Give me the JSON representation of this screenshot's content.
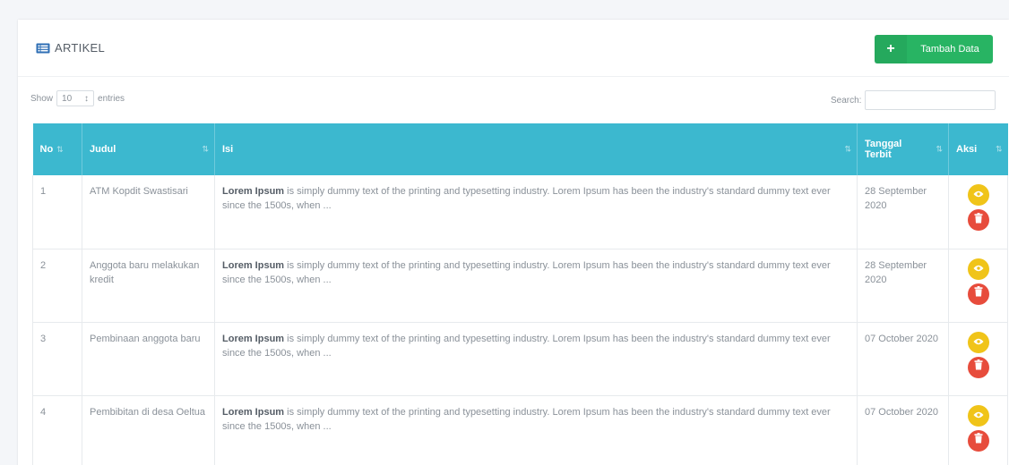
{
  "card": {
    "title": "ARTIKEL",
    "title_icon": "list-alt-icon",
    "add_button": {
      "icon": "plus-icon",
      "label": "Tambah Data"
    }
  },
  "length_menu": {
    "prefix": "Show",
    "value": "10",
    "suffix": "entries"
  },
  "search": {
    "label": "Search:",
    "value": "",
    "placeholder": ""
  },
  "table": {
    "headers": {
      "no": "No",
      "judul": "Judul",
      "isi": "Isi",
      "tanggal_line1": "Tanggal",
      "tanggal_line2": "Terbit",
      "aksi": "Aksi"
    },
    "rows": [
      {
        "no": "1",
        "judul": "ATM Kopdit Swastisari",
        "isi_bold": "Lorem Ipsum",
        "isi_rest": " is simply dummy text of the printing and typesetting industry. Lorem Ipsum has been the industry's standard dummy text ever since the 1500s, when ...",
        "tanggal": "28 September 2020"
      },
      {
        "no": "2",
        "judul": "Anggota baru melakukan kredit",
        "isi_bold": "Lorem Ipsum",
        "isi_rest": " is simply dummy text of the printing and typesetting industry. Lorem Ipsum has been the industry's standard dummy text ever since the 1500s, when ...",
        "tanggal": "28 September 2020"
      },
      {
        "no": "3",
        "judul": "Pembinaan anggota baru",
        "isi_bold": "Lorem Ipsum",
        "isi_rest": " is simply dummy text of the printing and typesetting industry. Lorem Ipsum has been the industry's standard dummy text ever since the 1500s, when ...",
        "tanggal": "07 October 2020"
      },
      {
        "no": "4",
        "judul": "Pembibitan di desa Oeltua",
        "isi_bold": "Lorem Ipsum",
        "isi_rest": " is simply dummy text of the printing and typesetting industry. Lorem Ipsum has been the industry's standard dummy text ever since the 1500s, when ...",
        "tanggal": "07 October 2020"
      }
    ]
  },
  "colors": {
    "header_bg": "#3cb8cf",
    "add_button": "#28b463",
    "view_button": "#f0c419",
    "delete_button": "#e74c3c",
    "title_icon": "#2f6fb5"
  }
}
